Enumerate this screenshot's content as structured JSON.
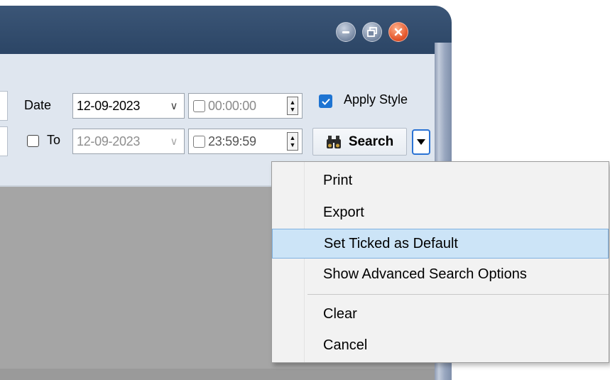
{
  "window": {
    "buttons": [
      {
        "name": "minimize-icon"
      },
      {
        "name": "restore-icon"
      },
      {
        "name": "close-icon"
      }
    ]
  },
  "filters": {
    "date_label": "Date",
    "to_label": "To",
    "to_checked": false,
    "date_from": "12-09-2023",
    "date_to": "12-09-2023",
    "time_from": "00:00:00",
    "time_to": "23:59:59",
    "time_from_checked": false,
    "time_to_checked": false
  },
  "apply_style": {
    "label": "Apply Style",
    "checked": true
  },
  "search": {
    "label": "Search",
    "icon": "binoculars-icon"
  },
  "context_menu": {
    "items": [
      {
        "label": "Print"
      },
      {
        "label": "Export"
      },
      {
        "label": "Set Ticked as Default",
        "highlighted": true
      },
      {
        "label": "Show Advanced Search Options"
      },
      {
        "label": "Clear"
      },
      {
        "label": "Cancel"
      }
    ]
  },
  "colors": {
    "titlebar": "#2f4b6e",
    "panel": "#dfe6ef",
    "content": "#a5a5a5",
    "accent": "#1e74d2",
    "menu_highlight": "#cce4f7"
  }
}
